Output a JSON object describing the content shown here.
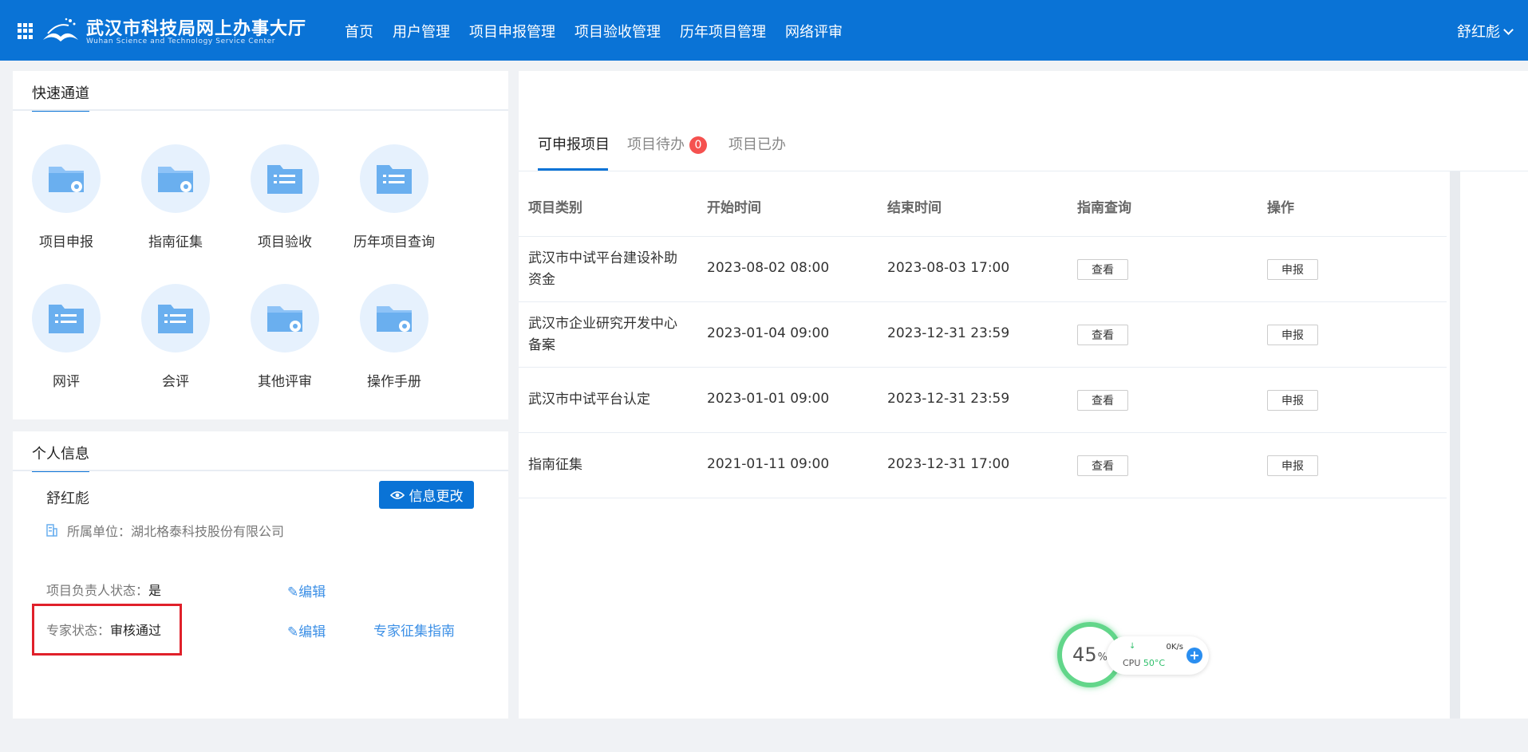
{
  "header": {
    "logo_title": "武汉市科技局网上办事大厅",
    "logo_subtitle": "Wuhan Science and Technology Service Center",
    "nav": [
      "首页",
      "用户管理",
      "项目申报管理",
      "项目验收管理",
      "历年项目管理",
      "网络评审"
    ],
    "user": "舒红彪"
  },
  "quick": {
    "tab": "快速通道",
    "items": [
      {
        "label": "项目申报",
        "icon": "folder-gear-icon"
      },
      {
        "label": "指南征集",
        "icon": "folder-gear-icon"
      },
      {
        "label": "项目验收",
        "icon": "list-folder-icon"
      },
      {
        "label": "历年项目查询",
        "icon": "list-folder-icon"
      },
      {
        "label": "网评",
        "icon": "list-folder-icon"
      },
      {
        "label": "会评",
        "icon": "list-folder-icon"
      },
      {
        "label": "其他评审",
        "icon": "folder-gear-icon"
      },
      {
        "label": "操作手册",
        "icon": "folder-gear-icon"
      }
    ]
  },
  "info": {
    "tab": "个人信息",
    "name": "舒红彪",
    "edit_button": "信息更改",
    "unit": "所属单位：湖北格泰科技股份有限公司",
    "leader_label": "项目负责人状态：",
    "leader_value": "是",
    "expert_label": "专家状态：",
    "expert_value": "审核通过",
    "edit_link": "编辑",
    "guide_link": "专家征集指南"
  },
  "projects": {
    "tabs": [
      {
        "label": "可申报项目"
      },
      {
        "label": "项目待办",
        "badge": "0"
      },
      {
        "label": "项目已办"
      }
    ],
    "columns": [
      "项目类别",
      "开始时间",
      "结束时间",
      "指南查询",
      "操作"
    ],
    "view_label": "查看",
    "apply_label": "申报",
    "rows": [
      {
        "category": "武汉市中试平台建设补助资金",
        "start": "2023-08-02 08:00",
        "end": "2023-08-03 17:00"
      },
      {
        "category": "武汉市企业研究开发中心备案",
        "start": "2023-01-04 09:00",
        "end": "2023-12-31 23:59"
      },
      {
        "category": "武汉市中试平台认定",
        "start": "2023-01-01 09:00",
        "end": "2023-12-31 23:59"
      },
      {
        "category": "指南征集",
        "start": "2021-01-11 09:00",
        "end": "2023-12-31 17:00"
      }
    ]
  },
  "cpu_widget": {
    "percent": "45",
    "percent_unit": "%",
    "speed": "0K/s",
    "cpu_label": "CPU",
    "temp": "50°C",
    "plus": "+"
  },
  "colors": {
    "brand": "#0a73d6",
    "link": "#3b8fe6",
    "badge": "#f5514f",
    "highlight_box": "#e0202a"
  }
}
